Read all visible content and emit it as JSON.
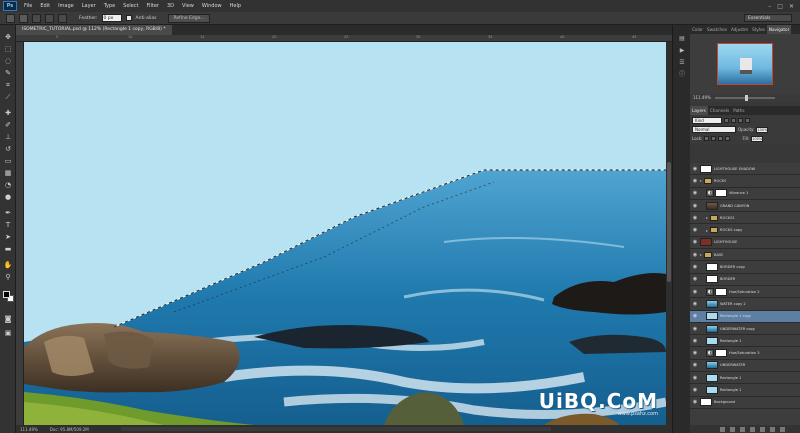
{
  "app": {
    "logo": "Ps"
  },
  "menu": [
    "File",
    "Edit",
    "Image",
    "Layer",
    "Type",
    "Select",
    "Filter",
    "3D",
    "View",
    "Window",
    "Help"
  ],
  "window_controls": [
    "–",
    "□",
    "✕"
  ],
  "options": {
    "feather_label": "Feather:",
    "feather_value": "0 px",
    "antialias_label": "Anti-alias",
    "refine_edge": "Refine Edge...",
    "workspace": "Essentials"
  },
  "document": {
    "tab_title": "ISOMETRIC_TUTORIAL.psd @ 112% (Rectangle 1 copy, RGB/8) *",
    "ruler_numbers": [
      "5",
      "10",
      "15",
      "20",
      "25",
      "30",
      "35",
      "40",
      "45"
    ]
  },
  "status": {
    "zoom": "111.49%",
    "doc": "Doc: 95.8M/509.2M"
  },
  "panels": {
    "top_tabs": [
      "Color",
      "Swatches",
      "Adjustm",
      "Styles",
      "Navigator"
    ],
    "active_top_tab": "Navigator",
    "nav_zoom": "111.49%",
    "layer_tabs": [
      "Layers",
      "Channels",
      "Paths"
    ],
    "active_layer_tab": "Layers",
    "kind_label": "Kind",
    "blend_mode": "Normal",
    "opacity_label": "Opacity:",
    "opacity_value": "100%",
    "lock_label": "Lock:",
    "fill_label": "Fill:",
    "fill_value": "100%"
  },
  "layers": [
    {
      "name": "LIGHTHOUSE SHADOW",
      "thumb": "white",
      "kind": "layer",
      "indent": 0,
      "selected": false
    },
    {
      "name": "ROCKS",
      "thumb": "",
      "kind": "folder",
      "indent": 0,
      "selected": false
    },
    {
      "name": "Vibrance 1",
      "thumb": "white",
      "kind": "adjust",
      "indent": 1,
      "selected": false
    },
    {
      "name": "GRAND CANYON",
      "thumb": "rock",
      "kind": "layer",
      "indent": 1,
      "selected": false
    },
    {
      "name": "ROCKS1",
      "thumb": "",
      "kind": "folder",
      "indent": 1,
      "selected": false
    },
    {
      "name": "ROCKS copy",
      "thumb": "",
      "kind": "folder",
      "indent": 1,
      "selected": false
    },
    {
      "name": "LIGHTHOUSE",
      "thumb": "red",
      "kind": "layer",
      "indent": 0,
      "selected": false
    },
    {
      "name": "BASE",
      "thumb": "",
      "kind": "folder",
      "indent": 0,
      "selected": false
    },
    {
      "name": "BORDER copy",
      "thumb": "white",
      "kind": "layer",
      "indent": 1,
      "selected": false
    },
    {
      "name": "BORDER",
      "thumb": "white",
      "kind": "layer",
      "indent": 1,
      "selected": false
    },
    {
      "name": "Hue/Saturation 2",
      "thumb": "white",
      "kind": "adjust",
      "indent": 1,
      "selected": false
    },
    {
      "name": "WATER copy 2",
      "thumb": "sea",
      "kind": "layer",
      "indent": 1,
      "selected": false
    },
    {
      "name": "Rectangle 1 copy",
      "thumb": "sky",
      "kind": "layer",
      "indent": 1,
      "selected": true
    },
    {
      "name": "UNDERWATER copy",
      "thumb": "sea",
      "kind": "layer",
      "indent": 1,
      "selected": false
    },
    {
      "name": "Rectangle 1",
      "thumb": "sky",
      "kind": "layer",
      "indent": 1,
      "selected": false
    },
    {
      "name": "Hue/Saturation 3",
      "thumb": "white",
      "kind": "adjust",
      "indent": 1,
      "selected": false
    },
    {
      "name": "UNDERWATER",
      "thumb": "sea",
      "kind": "layer",
      "indent": 1,
      "selected": false
    },
    {
      "name": "Rectangle 1",
      "thumb": "sky",
      "kind": "layer",
      "indent": 1,
      "selected": false
    },
    {
      "name": "Rectangle 1",
      "thumb": "sky",
      "kind": "layer",
      "indent": 1,
      "selected": false
    },
    {
      "name": "Background",
      "thumb": "white",
      "kind": "layer",
      "indent": 0,
      "selected": false
    }
  ],
  "watermark": {
    "main": "UiBQ.CoM",
    "sub": "www.psahz.com"
  },
  "colors": {
    "sky": "#b7e2f1",
    "sea": "#1f79ad",
    "selection": "#5c7fa3",
    "chrome": "#2b2b2b"
  }
}
